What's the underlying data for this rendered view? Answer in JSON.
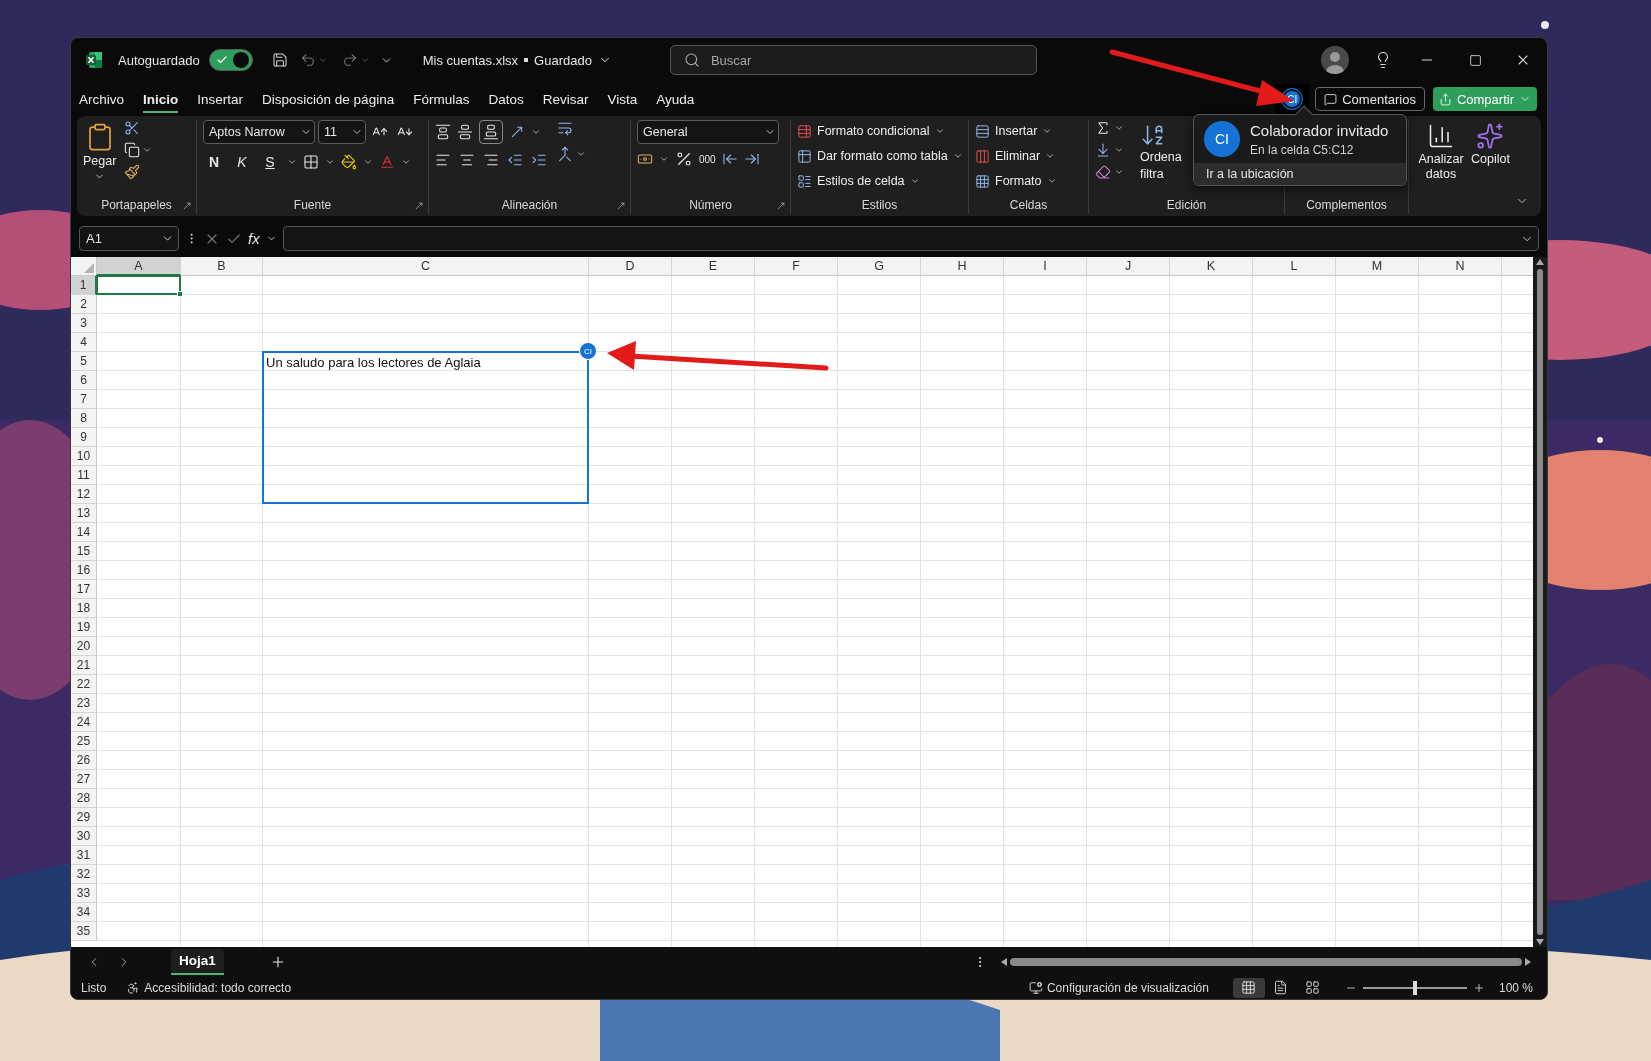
{
  "title_bar": {
    "autosave": {
      "label": "Autoguardado",
      "on": true
    },
    "file_name": "Mis cuentas.xlsx",
    "save_status": "Guardado",
    "search": {
      "placeholder": "Buscar"
    }
  },
  "menu_tabs": [
    {
      "label": "Archivo",
      "selected": false
    },
    {
      "label": "Inicio",
      "selected": true
    },
    {
      "label": "Insertar",
      "selected": false
    },
    {
      "label": "Disposición de página",
      "selected": false
    },
    {
      "label": "Fórmulas",
      "selected": false
    },
    {
      "label": "Datos",
      "selected": false
    },
    {
      "label": "Revisar",
      "selected": false
    },
    {
      "label": "Vista",
      "selected": false
    },
    {
      "label": "Ayuda",
      "selected": false
    }
  ],
  "presence": {
    "initials": "CI"
  },
  "comments_button": "Comentarios",
  "share_button": "Compartir",
  "ribbon": {
    "paste": "Pegar",
    "font_name": "Aptos Narrow",
    "font_size": "11",
    "bold": "N",
    "italic": "K",
    "underline": "S",
    "number_format": "General",
    "thousands": "000",
    "styles": [
      "Formato condicional",
      "Dar formato como tabla",
      "Estilos de celda"
    ],
    "cells": [
      "Insertar",
      "Eliminar",
      "Formato"
    ],
    "sort_filter": [
      "Ordena",
      "filtra"
    ],
    "add_ins": [
      "Analizar datos",
      "Copilot"
    ],
    "groups": [
      "Portapapeles",
      "Fuente",
      "Alineación",
      "Número",
      "Estilos",
      "Celdas",
      "Edición",
      "Complementos"
    ]
  },
  "collaborator_popup": {
    "initials": "CI",
    "name": "Colaborador invitado",
    "location": "En la celda C5:C12",
    "action": "Ir a la ubicación"
  },
  "formula_bar": {
    "name_box": "A1",
    "function_label": "fx"
  },
  "sheet": {
    "collaborator_badge": "CI",
    "columns": [
      {
        "label": "A",
        "selected": true
      },
      {
        "label": "B",
        "selected": false
      },
      {
        "label": "C",
        "selected": false
      },
      {
        "label": "D",
        "selected": false
      },
      {
        "label": "E",
        "selected": false
      },
      {
        "label": "F",
        "selected": false
      },
      {
        "label": "G",
        "selected": false
      },
      {
        "label": "H",
        "selected": false
      },
      {
        "label": "I",
        "selected": false
      },
      {
        "label": "J",
        "selected": false
      },
      {
        "label": "K",
        "selected": false
      },
      {
        "label": "L",
        "selected": false
      },
      {
        "label": "M",
        "selected": false
      },
      {
        "label": "N",
        "selected": false
      }
    ],
    "rows": [
      {
        "label": "1",
        "selected": true,
        "collaborator": false
      },
      {
        "label": "2",
        "selected": false,
        "collaborator": false
      },
      {
        "label": "3",
        "selected": false,
        "collaborator": false
      },
      {
        "label": "4",
        "selected": false,
        "collaborator": false
      },
      {
        "label": "5",
        "selected": false,
        "collaborator": true,
        "column_c": "Un saludo para los lectores de Aglaia"
      },
      {
        "label": "6",
        "selected": false,
        "collaborator": true
      },
      {
        "label": "7",
        "selected": false,
        "collaborator": true
      },
      {
        "label": "8",
        "selected": false,
        "collaborator": true
      },
      {
        "label": "9",
        "selected": false,
        "collaborator": true
      },
      {
        "label": "10",
        "selected": false,
        "collaborator": true
      },
      {
        "label": "11",
        "selected": false,
        "collaborator": true
      },
      {
        "label": "12",
        "selected": false,
        "collaborator": true
      },
      {
        "label": "13",
        "selected": false,
        "collaborator": false
      },
      {
        "label": "14",
        "selected": false,
        "collaborator": false
      },
      {
        "label": "15",
        "selected": false,
        "collaborator": false
      },
      {
        "label": "16",
        "selected": false,
        "collaborator": false
      },
      {
        "label": "17",
        "selected": false,
        "collaborator": false
      },
      {
        "label": "18",
        "selected": false,
        "collaborator": false
      },
      {
        "label": "19",
        "selected": false,
        "collaborator": false
      },
      {
        "label": "20",
        "selected": false,
        "collaborator": false
      },
      {
        "label": "21",
        "selected": false,
        "collaborator": false
      },
      {
        "label": "22",
        "selected": false,
        "collaborator": false
      },
      {
        "label": "23",
        "selected": false,
        "collaborator": false
      },
      {
        "label": "24",
        "selected": false,
        "collaborator": false
      },
      {
        "label": "25",
        "selected": false,
        "collaborator": false
      },
      {
        "label": "26",
        "selected": false,
        "collaborator": false
      },
      {
        "label": "27",
        "selected": false,
        "collaborator": false
      },
      {
        "label": "28",
        "selected": false,
        "collaborator": false
      },
      {
        "label": "29",
        "selected": false,
        "collaborator": false
      },
      {
        "label": "30",
        "selected": false,
        "collaborator": false
      },
      {
        "label": "31",
        "selected": false,
        "collaborator": false
      },
      {
        "label": "32",
        "selected": false,
        "collaborator": false
      },
      {
        "label": "33",
        "selected": false,
        "collaborator": false
      },
      {
        "label": "34",
        "selected": false,
        "collaborator": false
      },
      {
        "label": "35",
        "selected": false,
        "collaborator": false
      }
    ]
  },
  "sheet_tabs": [
    {
      "label": "Hoja1",
      "selected": true
    }
  ],
  "status_bar": {
    "state": "Listo",
    "accessibility": "Accesibilidad: todo correcto",
    "display_settings": "Configuración de visualización",
    "views": [
      {
        "kind": "normal",
        "selected": true
      },
      {
        "kind": "page_layout",
        "selected": false
      },
      {
        "kind": "page_break",
        "selected": false
      }
    ],
    "zoom": {
      "level": 0.5,
      "reading": "100 %"
    }
  }
}
